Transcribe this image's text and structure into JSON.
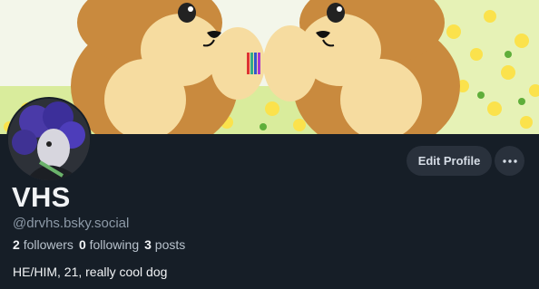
{
  "profile": {
    "display_name": "VHS",
    "handle": "@drvhs.bsky.social",
    "bio": "HE/HIM, 21, really cool dog",
    "stats": {
      "followers_count": "2",
      "followers_label": "followers",
      "following_count": "0",
      "following_label": "following",
      "posts_count": "3",
      "posts_label": "posts"
    }
  },
  "actions": {
    "edit_label": "Edit Profile",
    "more_icon": "ellipsis-icon"
  },
  "colors": {
    "background": "#161e27",
    "button_bg": "#29313c",
    "text_primary": "#f1f3f5",
    "text_secondary": "#8d9aa8"
  }
}
